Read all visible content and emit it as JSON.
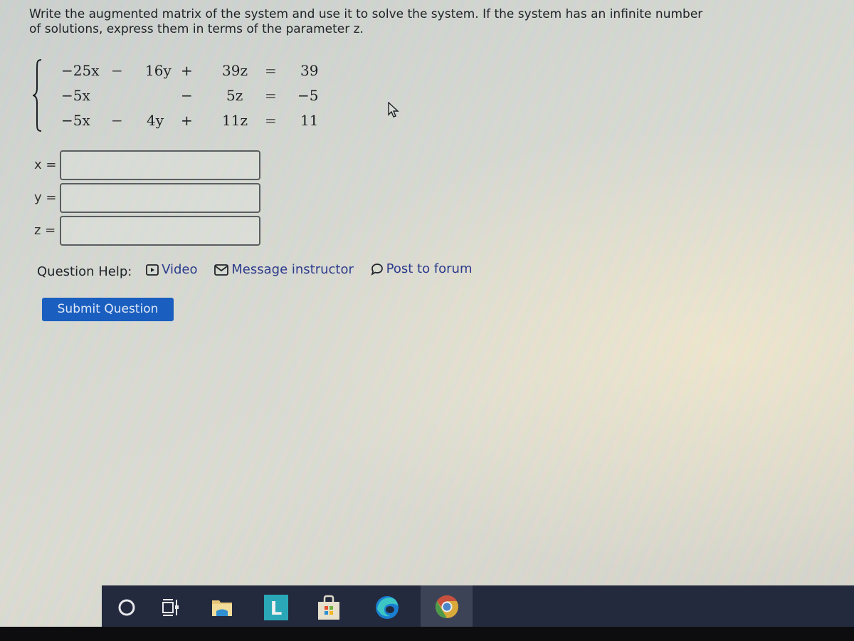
{
  "question": {
    "prompt": "Write the augmented matrix of the system and use it to solve the system. If the system has an infinite number of solutions, express them in terms of the parameter z.",
    "equations": [
      {
        "x_term": "−25x",
        "op1": "−",
        "y_term": "16y",
        "op2": "+",
        "z_term": "39z",
        "eq": "=",
        "rhs": "39"
      },
      {
        "x_term": "−5x",
        "op1": "",
        "y_term": "",
        "op2": "−",
        "z_term": "5z",
        "eq": "=",
        "rhs": "−5"
      },
      {
        "x_term": "−5x",
        "op1": "−",
        "y_term": "4y",
        "op2": "+",
        "z_term": "11z",
        "eq": "=",
        "rhs": "11"
      }
    ]
  },
  "answers": [
    {
      "label": "x =",
      "value": ""
    },
    {
      "label": "y =",
      "value": ""
    },
    {
      "label": "z =",
      "value": ""
    }
  ],
  "help": {
    "label": "Question Help:",
    "links": [
      {
        "label": "Video",
        "icon": "video-icon"
      },
      {
        "label": "Message instructor",
        "icon": "mail-icon"
      },
      {
        "label": "Post to forum",
        "icon": "chat-bubble-icon"
      }
    ]
  },
  "submit": {
    "label": "Submit Question"
  },
  "taskbar": {
    "items": [
      {
        "name": "search-cortana",
        "icon": "circle-icon",
        "active": false
      },
      {
        "name": "task-view",
        "icon": "task-view-icon",
        "active": false
      },
      {
        "name": "file-explorer",
        "icon": "folder-icon",
        "active": false
      },
      {
        "name": "l-app",
        "icon": "l-app-icon",
        "active": false,
        "letter": "L"
      },
      {
        "name": "microsoft-store",
        "icon": "store-bag-icon",
        "active": false
      },
      {
        "name": "edge",
        "icon": "edge-icon",
        "active": false
      },
      {
        "name": "chrome",
        "icon": "chrome-icon",
        "active": true
      }
    ]
  },
  "colors": {
    "link": "#2c3a8c",
    "submit_bg": "#1a5fc0",
    "taskbar_bg": "#242a3e"
  }
}
